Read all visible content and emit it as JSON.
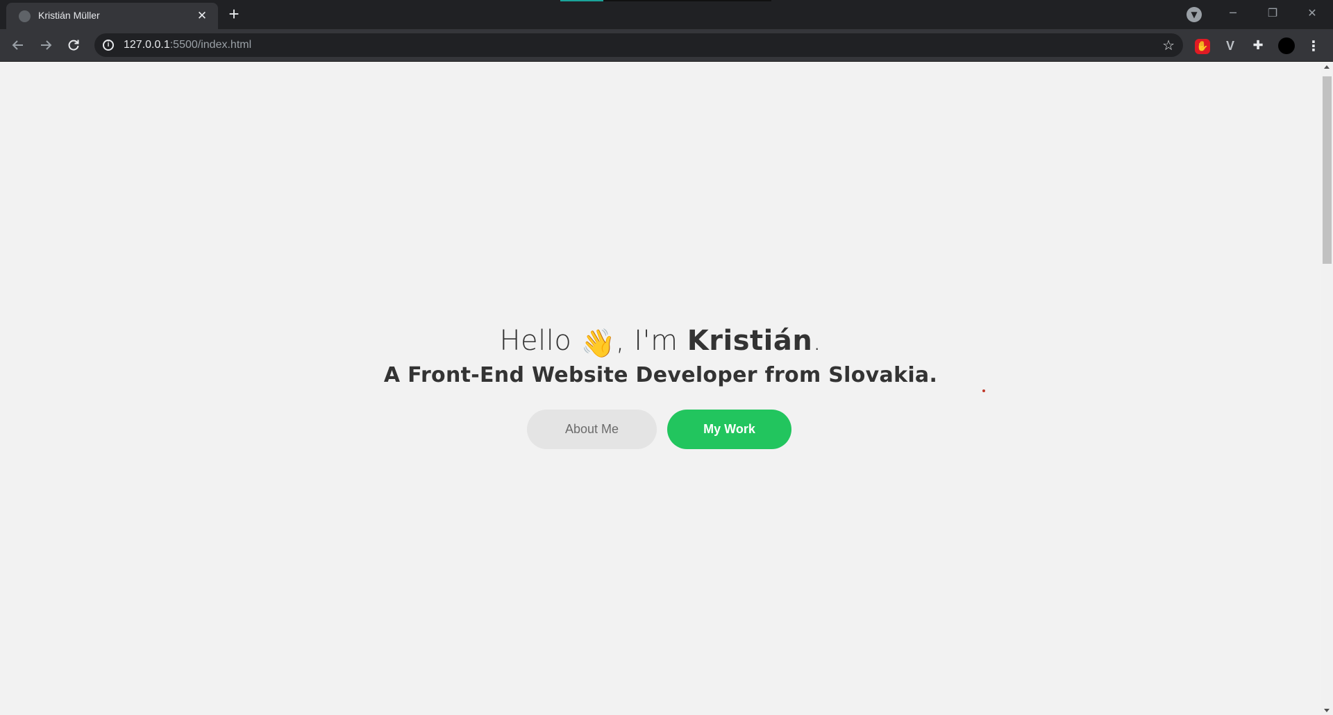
{
  "browser": {
    "tab_title": "Kristián Müller",
    "tab_close": "✕",
    "new_tab": "+",
    "url_host": "127.0.0.1",
    "url_rest": ":5500/index.html",
    "window_controls": {
      "minimize": "─",
      "restore": "❐",
      "close": "✕"
    },
    "icons": {
      "back": "arrow-left-icon",
      "forward": "arrow-right-icon",
      "reload": "reload-icon",
      "info": "info-icon",
      "bookmark": "star-icon",
      "extensions": "puzzle-icon",
      "menu": "kebab-menu-icon"
    }
  },
  "hero": {
    "greeting": "Hello ",
    "wave_emoji": "👋",
    "intro": ", I'm ",
    "name": "Kristián",
    "period": ".",
    "subtitle": "A Front-End Website Developer from Slovakia.",
    "about_button": "About Me",
    "work_button": "My Work"
  },
  "colors": {
    "accent": "#22c55e",
    "secondary_button": "#e4e4e4",
    "page_background": "#f2f2f2",
    "text": "#333333"
  }
}
